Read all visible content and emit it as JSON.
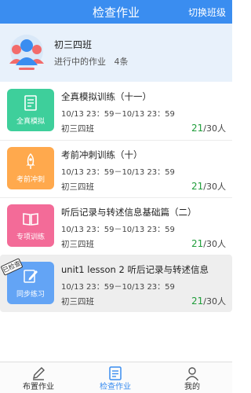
{
  "header": {
    "title": "检查作业",
    "switch_label": "切换班级"
  },
  "class_card": {
    "name": "初三四班",
    "progress_label": "进行中的作业",
    "progress_count": "4条"
  },
  "assignments": [
    {
      "title": "全真模拟训练（十一）",
      "time": "10/13 23：59－10/13 23：59",
      "class": "初三四班",
      "submitted": "21",
      "total": "/30人",
      "tile_label": "全真模拟",
      "tile_color": "#3ecf9b",
      "icon": "document-icon"
    },
    {
      "title": "考前冲刺训练（十）",
      "time": "10/13 23：59－10/13 23：59",
      "class": "初三四班",
      "submitted": "21",
      "total": "/30人",
      "tile_label": "考前冲刺",
      "tile_color": "#ffa94d",
      "icon": "rocket-icon"
    },
    {
      "title": "听后记录与转述信息基础篇（二）",
      "time": "10/13 23：59－10/13 23：59",
      "class": "初三四班",
      "submitted": "21",
      "total": "/30人",
      "tile_label": "专项训练",
      "tile_color": "#f36b98",
      "icon": "book-icon"
    },
    {
      "title": "unit1 lesson 2  听后记录与转述信息",
      "time": "10/13 23：59－10/13 23：59",
      "class": "初三四班",
      "submitted": "21",
      "total": "/30人",
      "tile_label": "同步练习",
      "tile_color": "#63a4f5",
      "icon": "edit-icon",
      "stamp": "已检查"
    }
  ],
  "tabbar": [
    {
      "label": "布置作业",
      "icon": "pen-icon",
      "active": false
    },
    {
      "label": "检查作业",
      "icon": "checklist-icon",
      "active": true
    },
    {
      "label": "我的",
      "icon": "user-icon",
      "active": false
    }
  ],
  "colors": {
    "accent": "#3a8df0",
    "count_green": "#1f9d3a"
  }
}
